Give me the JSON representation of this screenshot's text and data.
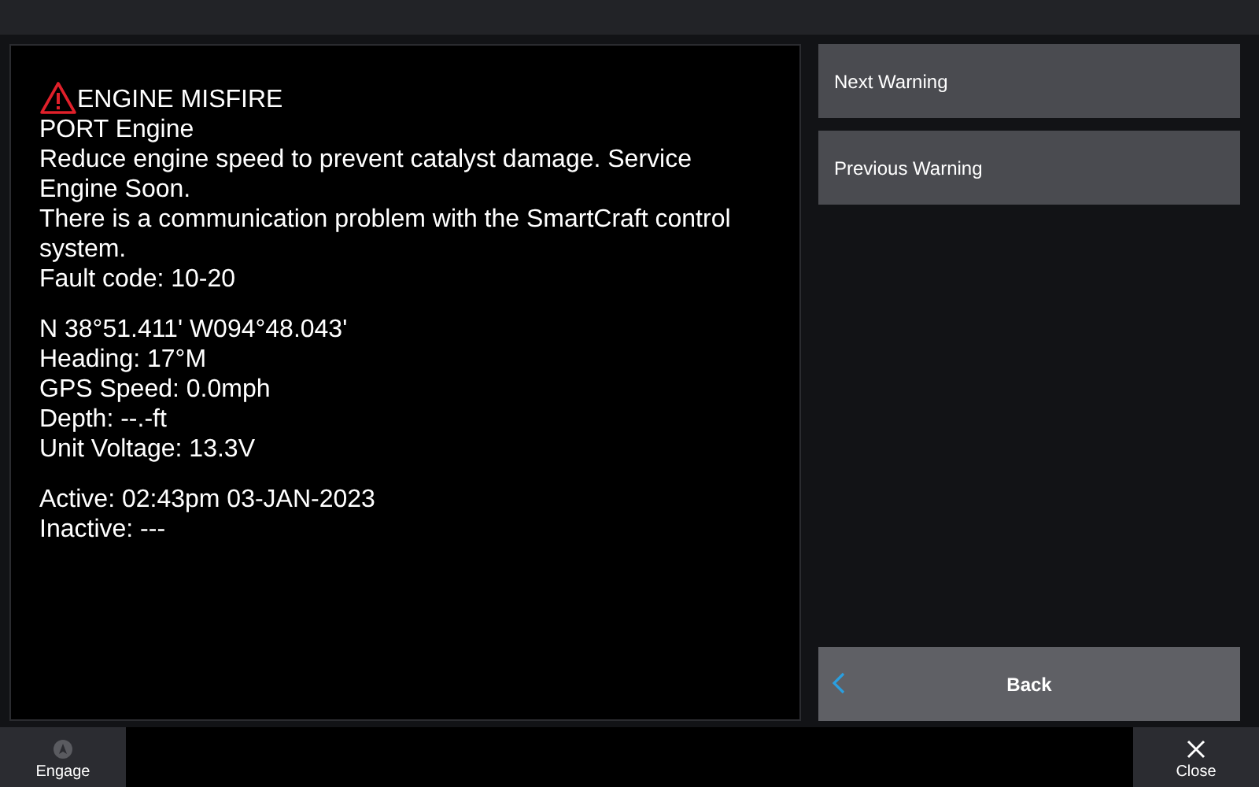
{
  "warning": {
    "title": "ENGINE MISFIRE",
    "groups": [
      [
        "PORT Engine",
        "Reduce engine speed to prevent catalyst damage. Service Engine Soon.",
        "There is a communication problem with the SmartCraft control system.",
        "Fault code: 10-20"
      ],
      [
        "N  38°51.411' W094°48.043'",
        "Heading: 17°M",
        "GPS Speed: 0.0mph",
        "Depth: --.-ft",
        "Unit Voltage: 13.3V"
      ],
      [
        "Active: 02:43pm 03-JAN-2023",
        "Inactive: ---"
      ]
    ]
  },
  "side_buttons": [
    {
      "label": "Next Warning",
      "kind": "plain"
    },
    {
      "label": "Previous Warning",
      "kind": "plain"
    },
    {
      "label": "Back",
      "kind": "back"
    }
  ],
  "bottom_bar": {
    "left": {
      "label": "Engage",
      "disabled": true
    },
    "right": {
      "label": "Close"
    }
  }
}
